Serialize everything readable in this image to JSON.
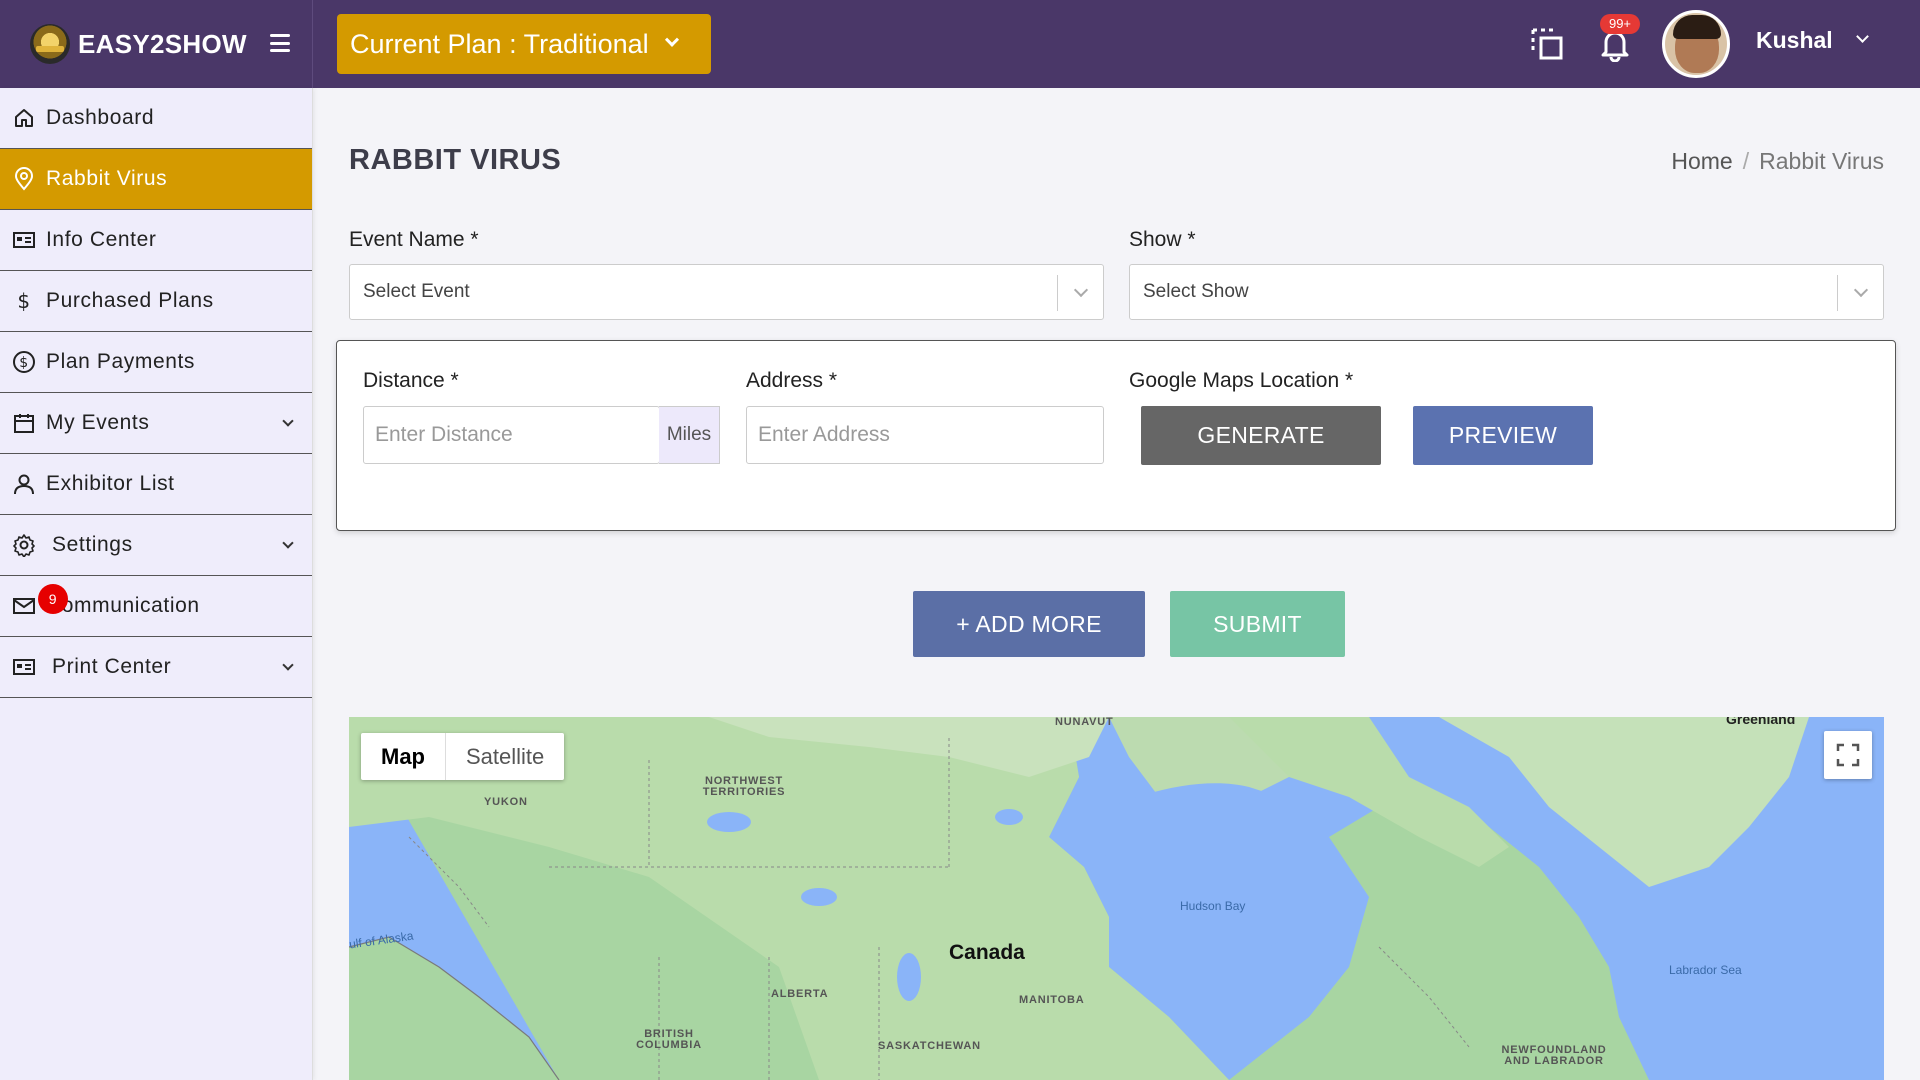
{
  "brand": {
    "name": "EASY2SHOW"
  },
  "header": {
    "plan_label": "Current Plan : Traditional",
    "notification_count": "99+",
    "user_name": "Kushal"
  },
  "sidebar": {
    "items": [
      {
        "label": "Dashboard",
        "icon": "home-icon"
      },
      {
        "label": "Rabbit Virus",
        "icon": "map-pin-icon",
        "active": true
      },
      {
        "label": "Info Center",
        "icon": "id-card-icon"
      },
      {
        "label": "Purchased Plans",
        "icon": "dollar-icon"
      },
      {
        "label": "Plan Payments",
        "icon": "dollar-circle-icon"
      },
      {
        "label": "My Events",
        "icon": "calendar-icon",
        "expandable": true
      },
      {
        "label": "Exhibitor List",
        "icon": "user-icon"
      },
      {
        "label": "Settings",
        "icon": "gear-icon",
        "expandable": true
      },
      {
        "label": "Communication",
        "icon": "mail-icon",
        "badge": "9"
      },
      {
        "label": "Print Center",
        "icon": "id-card-icon",
        "expandable": true
      }
    ]
  },
  "page": {
    "title": "RABBIT VIRUS",
    "breadcrumb": {
      "home": "Home",
      "current": "Rabbit Virus"
    }
  },
  "form": {
    "event_name_label": "Event Name *",
    "event_placeholder": "Select Event",
    "show_label": "Show *",
    "show_placeholder": "Select Show",
    "distance_label": "Distance *",
    "distance_placeholder": "Enter Distance",
    "distance_unit": "Miles",
    "address_label": "Address *",
    "address_placeholder": "Enter Address",
    "maps_label": "Google Maps Location *",
    "generate_label": "GENERATE",
    "preview_label": "PREVIEW",
    "add_more_label": "+ ADD MORE",
    "submit_label": "SUBMIT"
  },
  "map": {
    "type_map": "Map",
    "type_satellite": "Satellite",
    "labels": {
      "nunavut": "NUNAVUT",
      "greenland": "Greenland",
      "nwt": "NORTHWEST TERRITORIES",
      "yukon": "YUKON",
      "hudson_bay": "Hudson Bay",
      "gulf_alaska": "ulf of Alaska",
      "canada": "Canada",
      "alberta": "ALBERTA",
      "manitoba": "MANITOBA",
      "bc": "BRITISH COLUMBIA",
      "saskatchewan": "SASKATCHEWAN",
      "labrador_sea": "Labrador Sea",
      "newfoundland": "NEWFOUNDLAND AND LABRADOR"
    }
  },
  "colors": {
    "header_bg": "#4a3768",
    "accent": "#d49a00",
    "sidebar_bg": "#efedfb",
    "preview_btn": "#5b72b0",
    "submit_btn": "#77c5a5"
  }
}
